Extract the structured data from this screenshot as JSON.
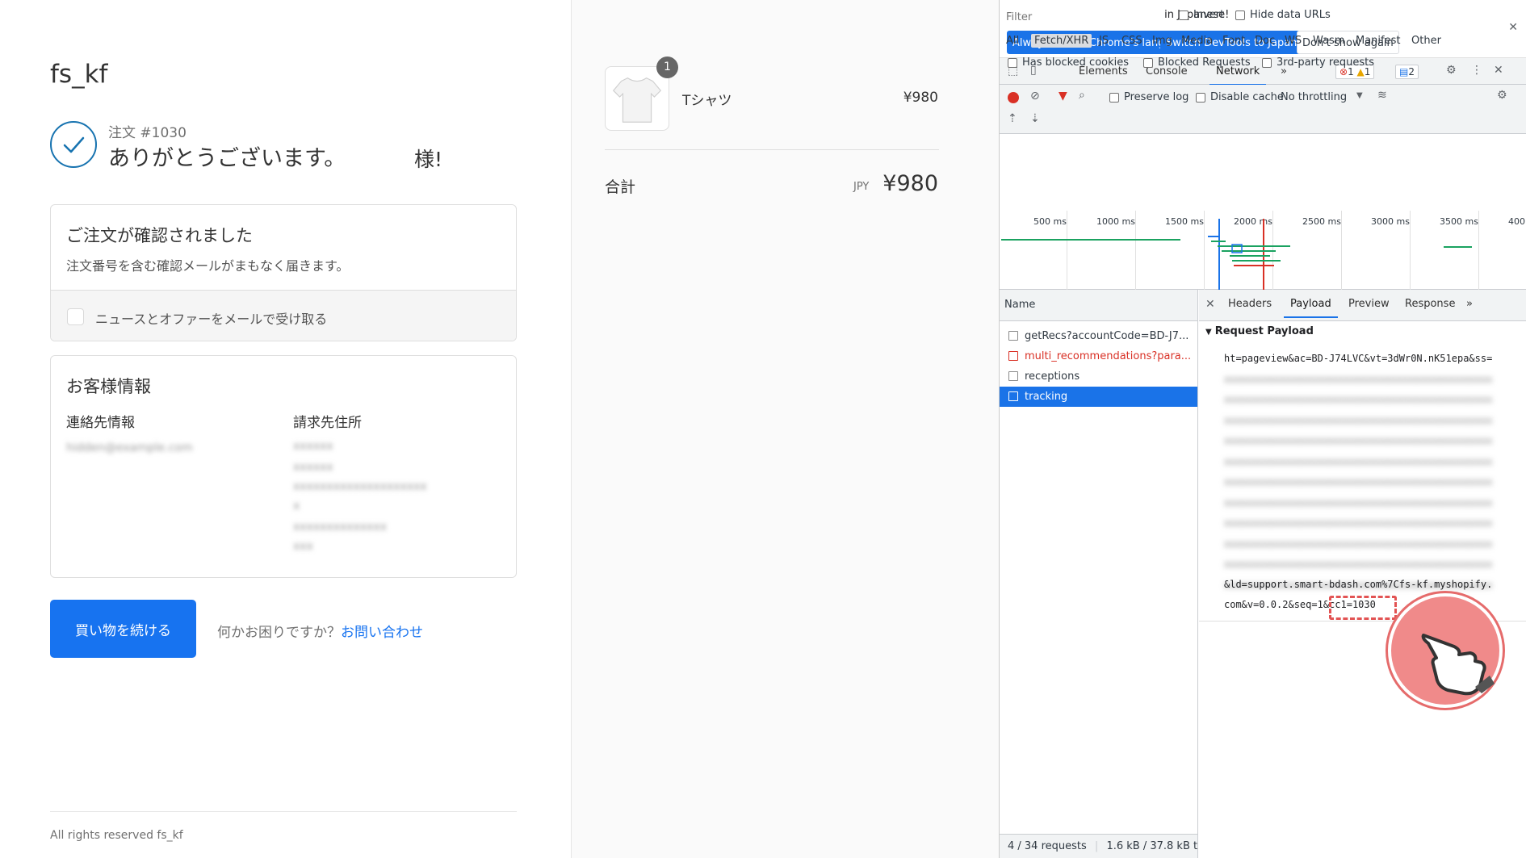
{
  "checkout": {
    "store_name": "fs_kf",
    "order_number": "注文 #1030",
    "thanks": "ありがとうございます。",
    "thanks_suffix": "様!",
    "confirm_title": "ご注文が確認されました",
    "confirm_desc": "注文番号を含む確認メールがまもなく届きます。",
    "newsletter_label": "ニュースとオファーをメールで受け取る",
    "customer_title": "お客様情報",
    "contact_heading": "連絡先情報",
    "billing_heading": "請求先住所",
    "contact_value": "hidden@example.com",
    "billing_lines": [
      "xxxxxx",
      "xxxxxx",
      "xxxxxxxxxxxxxxxxxxxx",
      "x",
      "xxxxxxxxxxxxxx",
      "xxx"
    ],
    "continue_button": "買い物を続ける",
    "help_text": "何かお困りですか？",
    "help_link": "お問い合わせ",
    "footer": "All rights reserved fs_kf"
  },
  "summary": {
    "item_quantity": "1",
    "item_name": "Tシャツ",
    "item_price": "¥980",
    "total_label": "合計",
    "total_currency": "JPY",
    "total_value": "¥980"
  },
  "devtools": {
    "info_text": "DevTools is now available in Japanese!",
    "btn_match": "Always match Chrome's language",
    "btn_switch": "Switch DevTools to Japanese",
    "btn_dont_show": "Don't show again",
    "tabs": [
      "Elements",
      "Console",
      "Network"
    ],
    "more_tabs": "»",
    "errors_count": "1",
    "warnings_count": "1",
    "messages_count": "2",
    "preserve_log": "Preserve log",
    "disable_cache": "Disable cache",
    "throttling": "No throttling",
    "filter_placeholder": "Filter",
    "invert": "Invert",
    "hide_data_urls": "Hide data URLs",
    "types": [
      "All",
      "Fetch/XHR",
      "JS",
      "CSS",
      "Img",
      "Media",
      "Font",
      "Doc",
      "WS",
      "Wasm",
      "Manifest",
      "Other"
    ],
    "has_blocked_cookies": "Has blocked cookies",
    "blocked_requests": "Blocked Requests",
    "third_party": "3rd-party requests",
    "ticks": [
      "500 ms",
      "1000 ms",
      "1500 ms",
      "2000 ms",
      "2500 ms",
      "3000 ms",
      "3500 ms",
      "400"
    ],
    "name_header": "Name",
    "requests": [
      {
        "name": "getRecs?accountCode=BD-J7...",
        "state": "normal"
      },
      {
        "name": "multi_recommendations?para...",
        "state": "error"
      },
      {
        "name": "receptions",
        "state": "normal"
      },
      {
        "name": "tracking",
        "state": "selected"
      }
    ],
    "status_requests": "4 / 34 requests",
    "status_size": "1.6 kB / 37.8 kB t",
    "detail_tabs": [
      "Headers",
      "Payload",
      "Preview",
      "Response"
    ],
    "payload_title": "Request Payload",
    "payload_first": "ht=pageview&ac=BD-J74LVC&vt=3dWr0N.nK51epa&ss=",
    "payload_blurred": [
      "xxxxxxxxxxxxxxxxxxxxxxxxxxxxxxxxxxxxxxxxxxxxxx",
      "xxxxxxxxxxxxxxxxxxxxxxxxxxxxxxxxxxxxxxxxxxxxxx",
      "xxxxxxxxxxxxxxxxxxxxxxxxxxxxxxxxxxxxxxxxxxxxxx",
      "xxxxxxxxxxxxxxxxxxxxxxxxxxxxxxxxxxxxxxxxxxxxxx",
      "xxxxxxxxxxxxxxxxxxxxxxxxxxxxxxxxxxxxxxxxxxxxxx",
      "xxxxxxxxxxxxxxxxxxxxxxxxxxxxxxxxxxxxxxxxxxxxxx",
      "xxxxxxxxxxxxxxxxxxxxxxxxxxxxxxxxxxxxxxxxxxxxxx",
      "xxxxxxxxxxxxxxxxxxxxxxxxxxxxxxxxxxxxxxxxxxxxxx",
      "xxxxxxxxxxxxxxxxxxxxxxxxxxxxxxxxxxxxxxxxxxxxxx",
      "xxxxxxxxxxxxxxxxxxxxxxxxxxxxxxxxxxxxxxxxxxxxxx",
      "xxxxxxxxxxxxxxxxxxxxxxxxxxxxxxxxxxxxxxxxxxxxxx"
    ],
    "payload_line_ld": "&ld=support.smart-bdash.com%7Cfs-kf.myshopify.",
    "payload_line_last": "com&v=0.0.2&seq=1&cc1=1030"
  },
  "colors": {
    "accent": "#1773f0",
    "devtools_blue": "#1a73e8",
    "error_red": "#d93025",
    "highlight": "#e25353"
  }
}
